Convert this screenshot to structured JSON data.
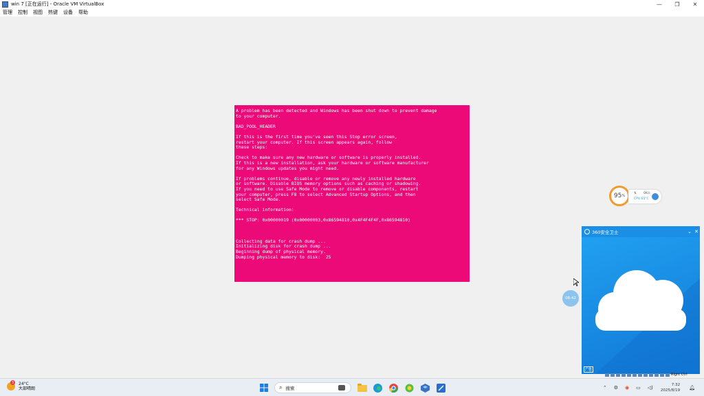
{
  "window": {
    "title": "win 7 [正在运行] - Oracle VM VirtualBox",
    "controls": {
      "minimize": "—",
      "maximize": "❐",
      "close": "✕"
    }
  },
  "menu": [
    "管理",
    "控制",
    "视图",
    "热键",
    "设备",
    "帮助"
  ],
  "bsod": {
    "background": "#ec0a78",
    "lines": [
      "A problem has been detected and Windows has been shut down to prevent damage",
      "to your computer.",
      "",
      "BAD_POOL_HEADER",
      "",
      "If this is the first time you've seen this Stop error screen,",
      "restart your computer. If this screen appears again, follow",
      "these steps:",
      "",
      "Check to make sure any new hardware or software is properly installed.",
      "If this is a new installation, ask your hardware or software manufacturer",
      "for any Windows updates you might need.",
      "",
      "If problems continue, disable or remove any newly installed hardware",
      "or software. Disable BIOS memory options such as caching or shadowing.",
      "If you need to use Safe Mode to remove or disable components, restart",
      "your computer, press F8 to select Advanced Startup Options, and then",
      "select Safe Mode.",
      "",
      "Technical information:",
      "",
      "*** STOP: 0x00000019 (0x00000003,0x86594810,0x4F4F4F4F,0x86594810)",
      "",
      "",
      "",
      "Collecting data for crash dump ...",
      "Initializing disk for crash dump ...",
      "Beginning dump of physical memory.",
      "Dumping physical memory to disk:  25"
    ]
  },
  "speedball": {
    "percent": "95",
    "percent_unit": "%",
    "net": "0K/s",
    "cpu": "CPU 65°C",
    "accent": "#f39a2e"
  },
  "popup": {
    "title": "360安全卫士",
    "ad_label": "广告",
    "color": "#1b8fe5"
  },
  "bubble_time": "08:42",
  "guest_tray_text": "Right Ctrl",
  "taskbar": {
    "weather": {
      "badge": "3",
      "temp": "24°C",
      "desc": "大部晴朗"
    },
    "search_placeholder": "搜索",
    "clock": {
      "time": "7:32",
      "date": "2025/8/19"
    },
    "apps": [
      "start-icon",
      "task-view-icon",
      "file-explorer-icon",
      "edge-icon",
      "chrome-icon",
      "360-icon",
      "virtualbox-icon",
      "snip-icon"
    ]
  }
}
